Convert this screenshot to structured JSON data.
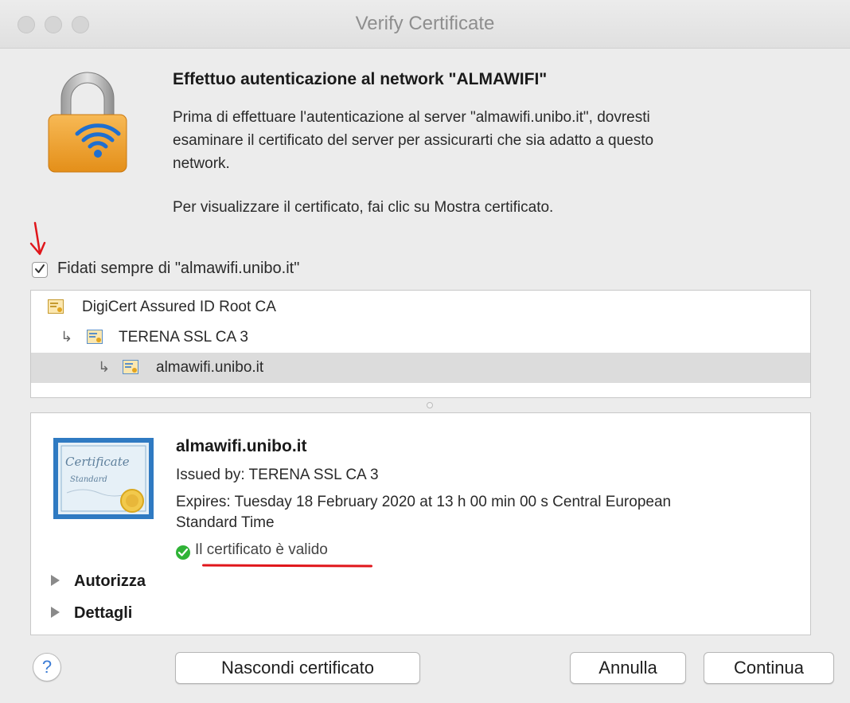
{
  "window": {
    "title": "Verify Certificate"
  },
  "header": {
    "heading": "Effettuo autenticazione al network \"ALMAWIFI\"",
    "paragraph_lines": [
      "Prima di effettuare l'autenticazione al server \"almawifi.unibo.it\", dovresti",
      "esaminare il certificato del server per assicurarti che sia adatto a questo",
      "network."
    ],
    "instruction": "Per visualizzare il certificato, fai clic su Mostra certificato.",
    "icon": "lock-wifi-icon"
  },
  "trust": {
    "checked": true,
    "label": "Fidati sempre di \"almawifi.unibo.it\"",
    "annotation_color": "#e0161b"
  },
  "chain": {
    "items": [
      {
        "label": "DigiCert Assured ID Root CA",
        "icon": "certificate-icon"
      },
      {
        "label": "TERENA SSL CA 3",
        "icon": "certificate-icon"
      },
      {
        "label": "almawifi.unibo.it",
        "icon": "certificate-icon",
        "selected": true
      }
    ]
  },
  "details": {
    "name": "almawifi.unibo.it",
    "issued_by": "Issued by: TERENA SSL CA 3",
    "expires_line1": "Expires: Tuesday 18 February 2020 at 13 h 00 min 00 s Central European",
    "expires_line2": "Standard Time",
    "status": "Il certificato è valido",
    "status_color": "#2fb336",
    "sections": [
      "Autorizza",
      "Dettagli"
    ],
    "cert_image_text": [
      "Certificate",
      "Standard"
    ]
  },
  "buttons": {
    "help": "?",
    "hide_certificate": "Nascondi certificato",
    "cancel": "Annulla",
    "continue": "Continua"
  }
}
